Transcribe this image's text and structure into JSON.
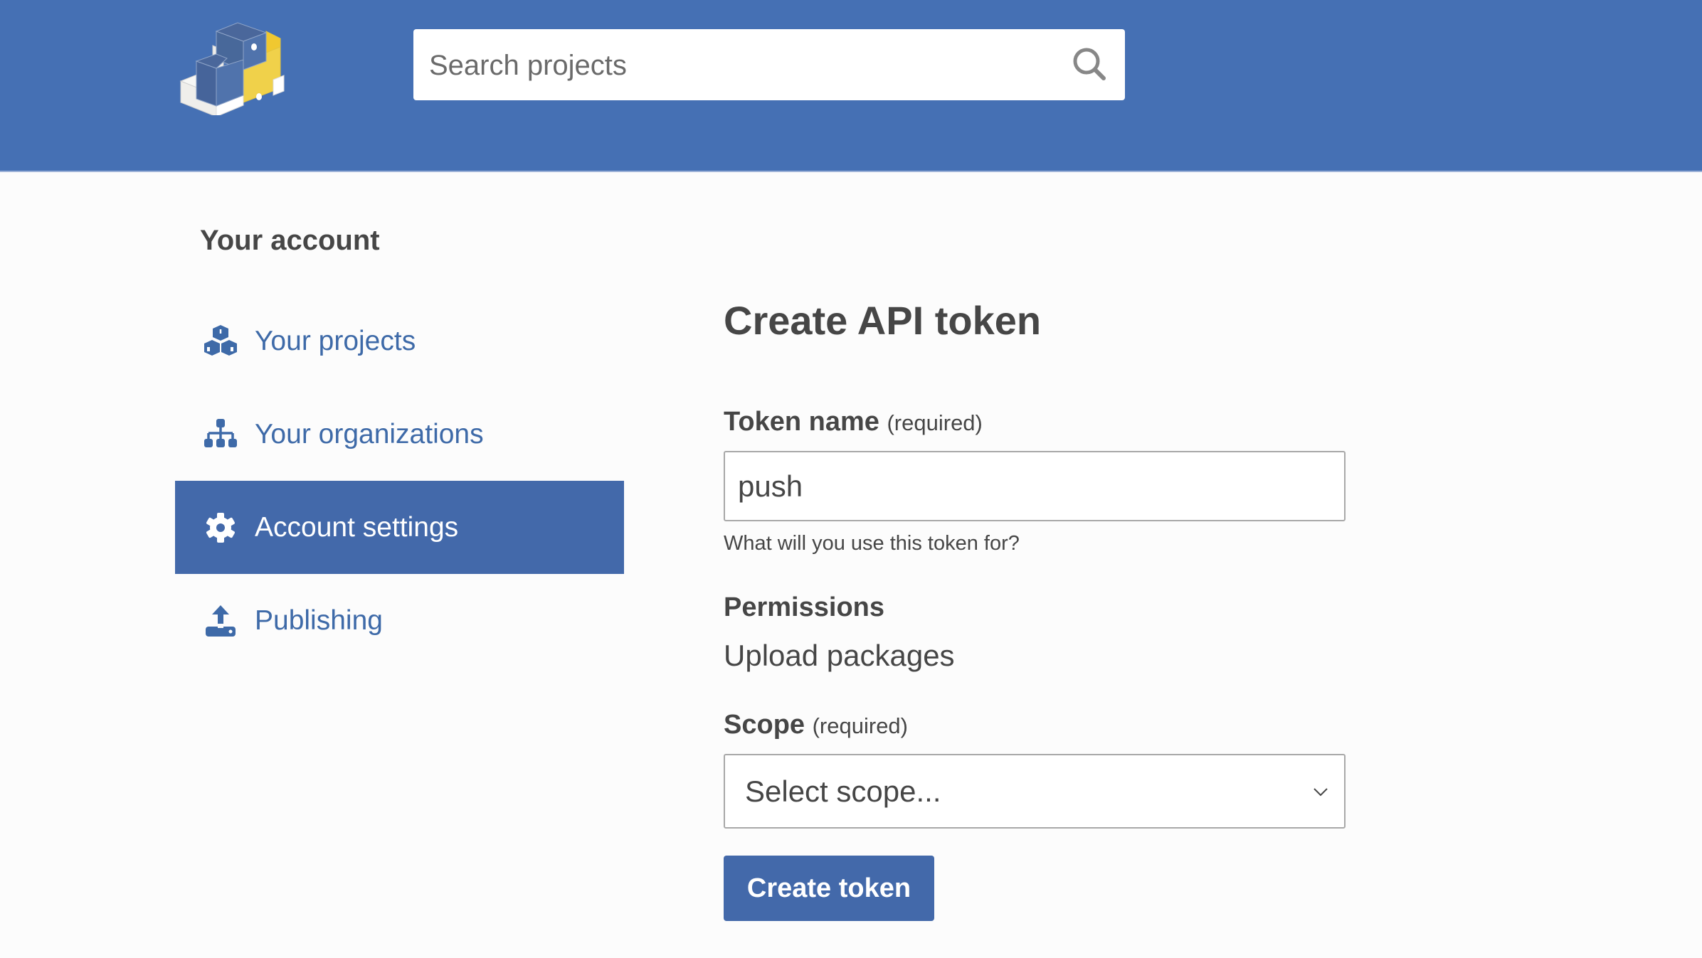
{
  "header": {
    "logo_alt": "PyPI",
    "search": {
      "placeholder": "Search projects",
      "value": "",
      "icon": "search-icon"
    }
  },
  "sidebar": {
    "title": "Your account",
    "items": [
      {
        "label": "Your projects",
        "icon": "cubes-icon",
        "active": false
      },
      {
        "label": "Your organizations",
        "icon": "sitemap-icon",
        "active": false
      },
      {
        "label": "Account settings",
        "icon": "gear-icon",
        "active": true
      },
      {
        "label": "Publishing",
        "icon": "upload-icon",
        "active": false
      }
    ]
  },
  "form": {
    "title": "Create API token",
    "token_name": {
      "label": "Token name",
      "required_note": "(required)",
      "value": "push",
      "help": "What will you use this token for?"
    },
    "permissions": {
      "label": "Permissions",
      "value": "Upload packages"
    },
    "scope": {
      "label": "Scope",
      "required_note": "(required)",
      "selected": "Select scope..."
    },
    "submit_label": "Create token"
  },
  "colors": {
    "brand": "#4570b4",
    "active_nav": "#4369aa",
    "link": "#3e6aa8",
    "logo_yellow": "#f0d14a"
  }
}
